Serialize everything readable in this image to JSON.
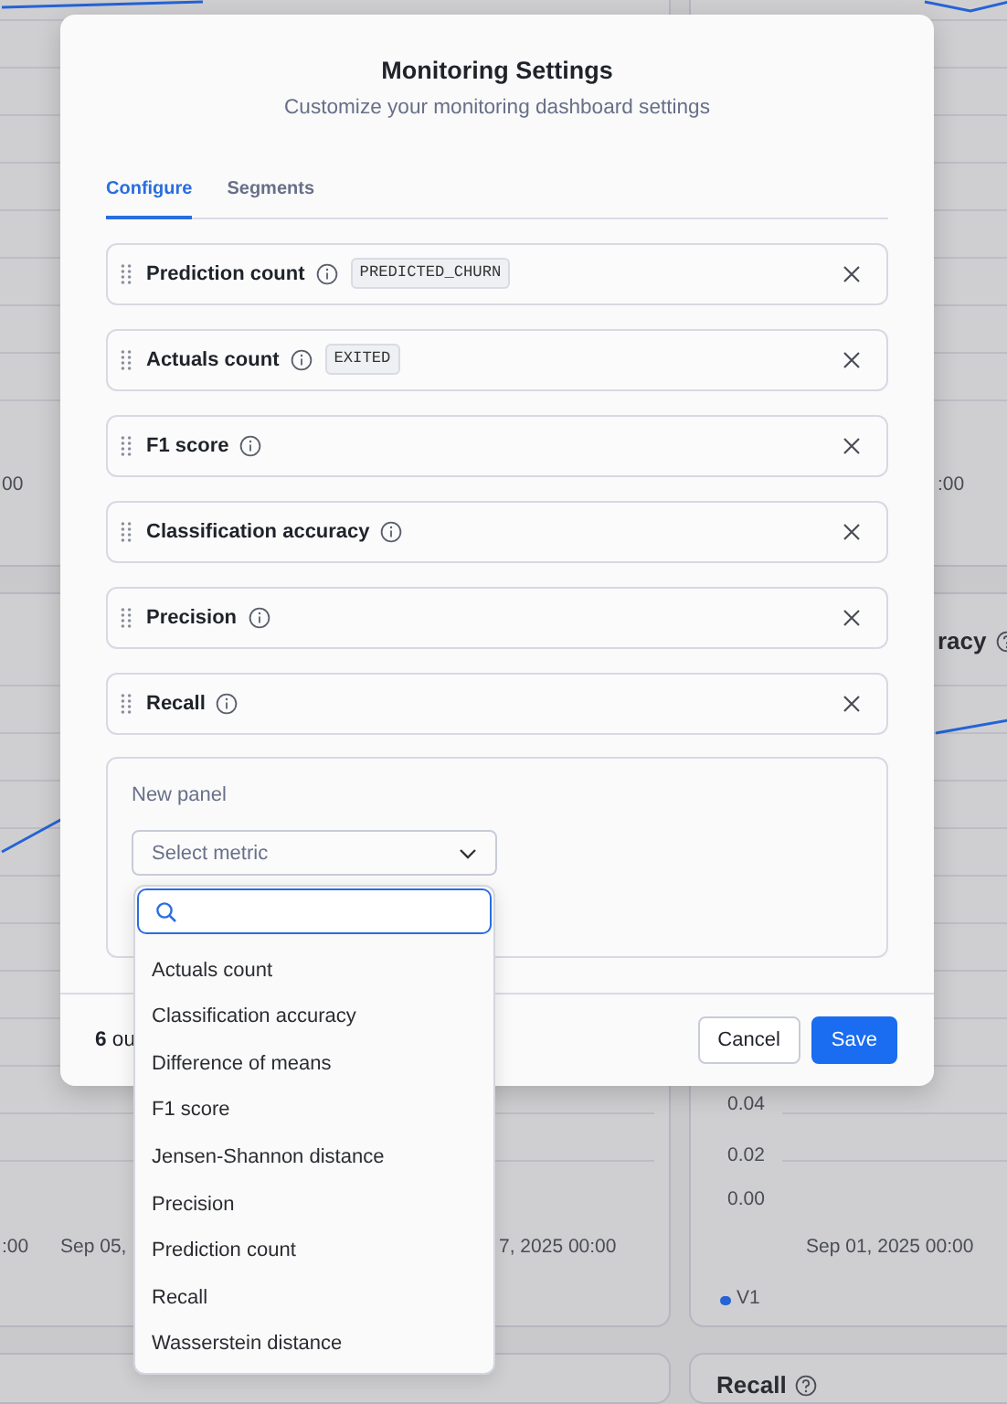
{
  "dashboard": {
    "panels": [
      {
        "x_labels": [
          "00"
        ]
      },
      {
        "x_labels": [
          ":00"
        ]
      },
      {
        "x_labels": [
          ":00",
          "Sep 05,",
          "7, 2025 00:00"
        ]
      },
      {
        "title": "racy",
        "y_labels": [
          "0.04",
          "0.02",
          "0.00"
        ],
        "x_labels": [
          "Sep 01, 2025 00:00"
        ],
        "legend": [
          {
            "label": "V1",
            "color": "#2563d6"
          }
        ]
      },
      {
        "title": "Recall"
      }
    ]
  },
  "modal": {
    "title": "Monitoring Settings",
    "subtitle": "Customize your monitoring dashboard settings",
    "tabs": [
      {
        "label": "Configure",
        "selected": true
      },
      {
        "label": "Segments",
        "selected": false
      }
    ],
    "panels": [
      {
        "name": "Prediction count",
        "tag": "PREDICTED_CHURN"
      },
      {
        "name": "Actuals count",
        "tag": "EXITED"
      },
      {
        "name": "F1 score"
      },
      {
        "name": "Classification accuracy"
      },
      {
        "name": "Precision"
      },
      {
        "name": "Recall"
      }
    ],
    "new_panel": {
      "label": "New panel",
      "select": {
        "placeholder": "Select metric",
        "expanded": true
      }
    },
    "dropdown": {
      "options": [
        "Actuals count",
        "Classification accuracy",
        "Difference of means",
        "F1 score",
        "Jensen-Shannon distance",
        "Precision",
        "Prediction count",
        "Recall",
        "Wasserstein distance"
      ]
    },
    "footer": {
      "summary": "**6** ou",
      "buttons": [
        {
          "label": "Cancel",
          "kind": "secondary"
        },
        {
          "label": "Save",
          "kind": "primary"
        }
      ]
    }
  }
}
